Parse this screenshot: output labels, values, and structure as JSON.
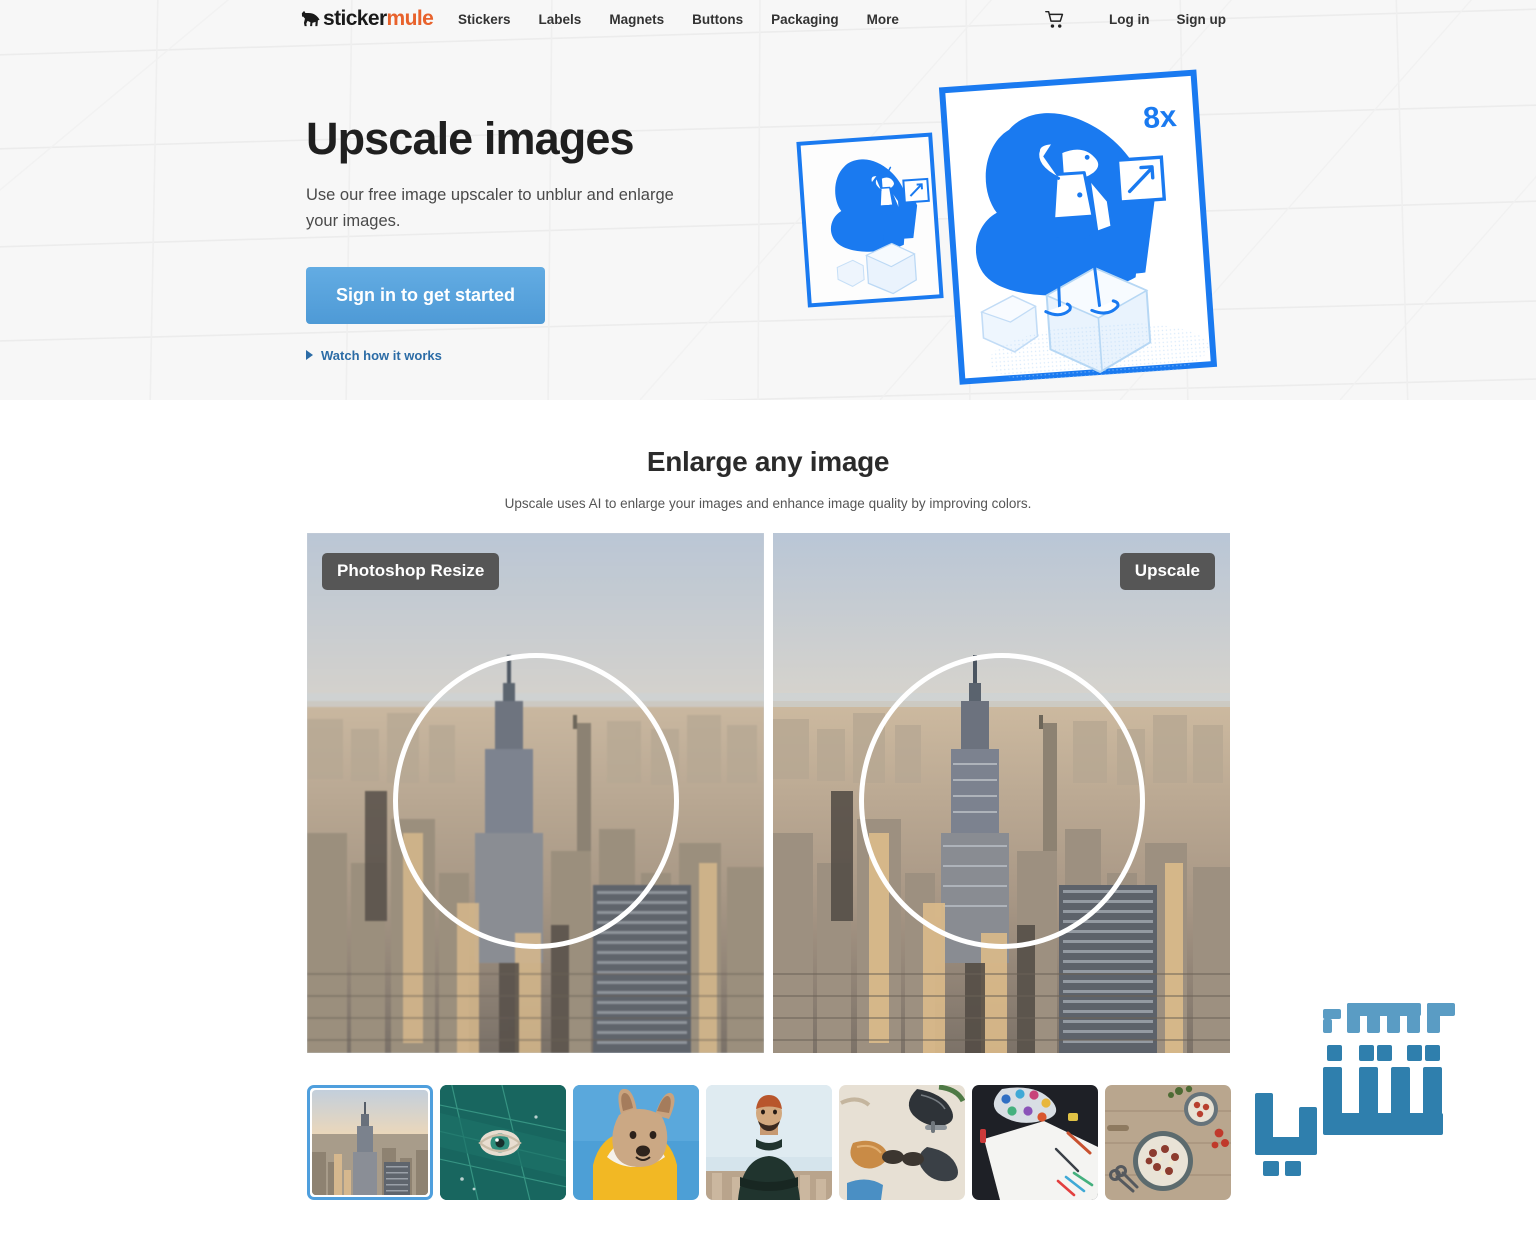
{
  "brand": {
    "logo_part1": "sticker",
    "logo_part2": "mule",
    "logo_icon": "mule-silhouette-icon",
    "orange": "#e8622c",
    "blue": "#1a73e8"
  },
  "header": {
    "nav": [
      {
        "label": "Stickers"
      },
      {
        "label": "Labels"
      },
      {
        "label": "Magnets"
      },
      {
        "label": "Buttons"
      },
      {
        "label": "Packaging"
      },
      {
        "label": "More"
      }
    ],
    "cart_icon": "shopping-cart-icon",
    "login_label": "Log in",
    "signup_label": "Sign up"
  },
  "hero": {
    "title": "Upscale images",
    "subtitle": "Use our free image upscaler to unblur and enlarge your images.",
    "cta_label": "Sign in to get started",
    "cta_color": "#4e9ad6",
    "watch_label": "Watch how it works",
    "watch_icon": "play-triangle-icon",
    "illustration": {
      "name": "upscale-cards-illustration",
      "badge": "8x",
      "accent": "#1a7af0"
    }
  },
  "section": {
    "title": "Enlarge any image",
    "subtitle": "Upscale uses AI to enlarge your images and enhance image quality by improving colors.",
    "comparison": {
      "left": {
        "badge": "Photoshop Resize",
        "image_name": "new-york-city-skyline-blurry",
        "magnifier": "white-circle-overlay"
      },
      "right": {
        "badge": "Upscale",
        "image_name": "new-york-city-skyline-sharp",
        "magnifier": "white-circle-overlay"
      },
      "badge_bg": "#565656"
    },
    "thumbnails": [
      {
        "name": "thumb-nyc-skyline",
        "selected": true
      },
      {
        "name": "thumb-leaf-eye",
        "selected": false
      },
      {
        "name": "thumb-dog-yellow-hoodie",
        "selected": false
      },
      {
        "name": "thumb-man-turtleneck",
        "selected": false
      },
      {
        "name": "thumb-shoes-flatlay",
        "selected": false
      },
      {
        "name": "thumb-art-palette",
        "selected": false
      },
      {
        "name": "thumb-food-flatlay",
        "selected": false
      }
    ],
    "selected_border_color": "#4f9fdd"
  },
  "watermark": {
    "name": "arabic-site-watermark",
    "line1": "مهووس",
    "line2": "تقني",
    "color": "#2f7fad"
  }
}
